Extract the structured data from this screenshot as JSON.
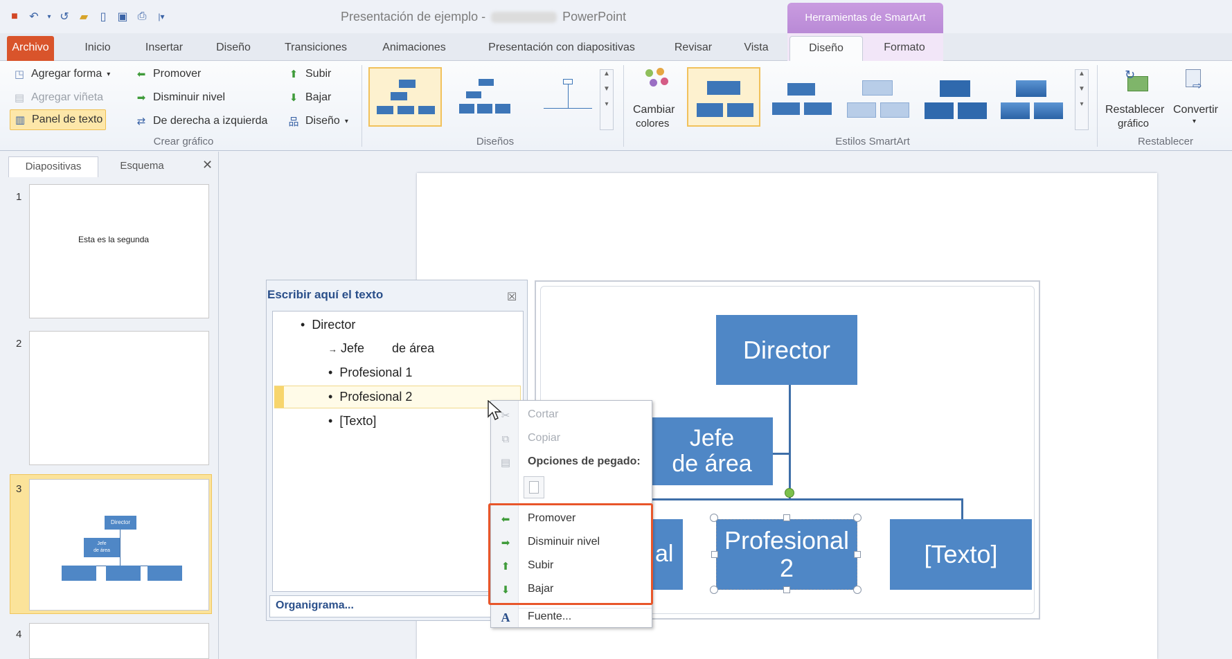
{
  "window": {
    "title": "Presentación de ejemplo  -",
    "app": "PowerPoint"
  },
  "context_tab": "Herramientas de SmartArt",
  "tabs": [
    {
      "label": "Archivo"
    },
    {
      "label": "Inicio"
    },
    {
      "label": "Insertar"
    },
    {
      "label": "Diseño"
    },
    {
      "label": "Transiciones"
    },
    {
      "label": "Animaciones"
    },
    {
      "label": "Presentación con diapositivas"
    },
    {
      "label": "Revisar"
    },
    {
      "label": "Vista"
    },
    {
      "label": "Diseño"
    },
    {
      "label": "Formato"
    }
  ],
  "ribbon": {
    "crear": {
      "agregar_forma": "Agregar forma",
      "agregar_vineta": "Agregar viñeta",
      "panel_texto": "Panel de texto",
      "promover": "Promover",
      "disminuir": "Disminuir nivel",
      "derecha_izquierda": "De derecha a izquierda",
      "subir": "Subir",
      "bajar": "Bajar",
      "diseno": "Diseño",
      "label": "Crear gráfico"
    },
    "disenos_label": "Diseños",
    "cambiar_colores": [
      "Cambiar",
      "colores"
    ],
    "estilos_label": "Estilos SmartArt",
    "restablecer_grafico": [
      "Restablecer",
      "gráfico"
    ],
    "convertir": "Convertir",
    "restablecer_label": "Restablecer"
  },
  "left_panel": {
    "tabs": [
      "Diapositivas",
      "Esquema"
    ],
    "slides": [
      {
        "num": "1",
        "text": "Esta es la segunda"
      },
      {
        "num": "2",
        "text": ""
      },
      {
        "num": "3",
        "text": ""
      },
      {
        "num": "4",
        "text": ""
      }
    ],
    "thumb3": {
      "director": "Director",
      "jefe": [
        "Jefe",
        "de área"
      ]
    }
  },
  "text_pane": {
    "title": "Escribir aquí el texto",
    "lines": [
      "Director",
      "Jefe        de área",
      "Profesional 1",
      "Profesional 2",
      "[Texto]"
    ],
    "footer": "Organigrama..."
  },
  "smartart": {
    "director": "Director",
    "jefe": [
      "Jefe",
      "de área"
    ],
    "left_partial": "al",
    "profesional2": [
      "Profesional",
      "2"
    ],
    "texto": "[Texto]"
  },
  "context_menu": {
    "cortar": "Cortar",
    "copiar": "Copiar",
    "opciones_pegado": "Opciones de pegado:",
    "promover": "Promover",
    "disminuir": "Disminuir nivel",
    "subir": "Subir",
    "bajar": "Bajar",
    "fuente": "Fuente..."
  },
  "colors": {
    "accent_orange": "#e8562a",
    "smartart_blue": "#4f87c6",
    "archivo": "#d9542b",
    "context_purple": "#b98ad6"
  }
}
